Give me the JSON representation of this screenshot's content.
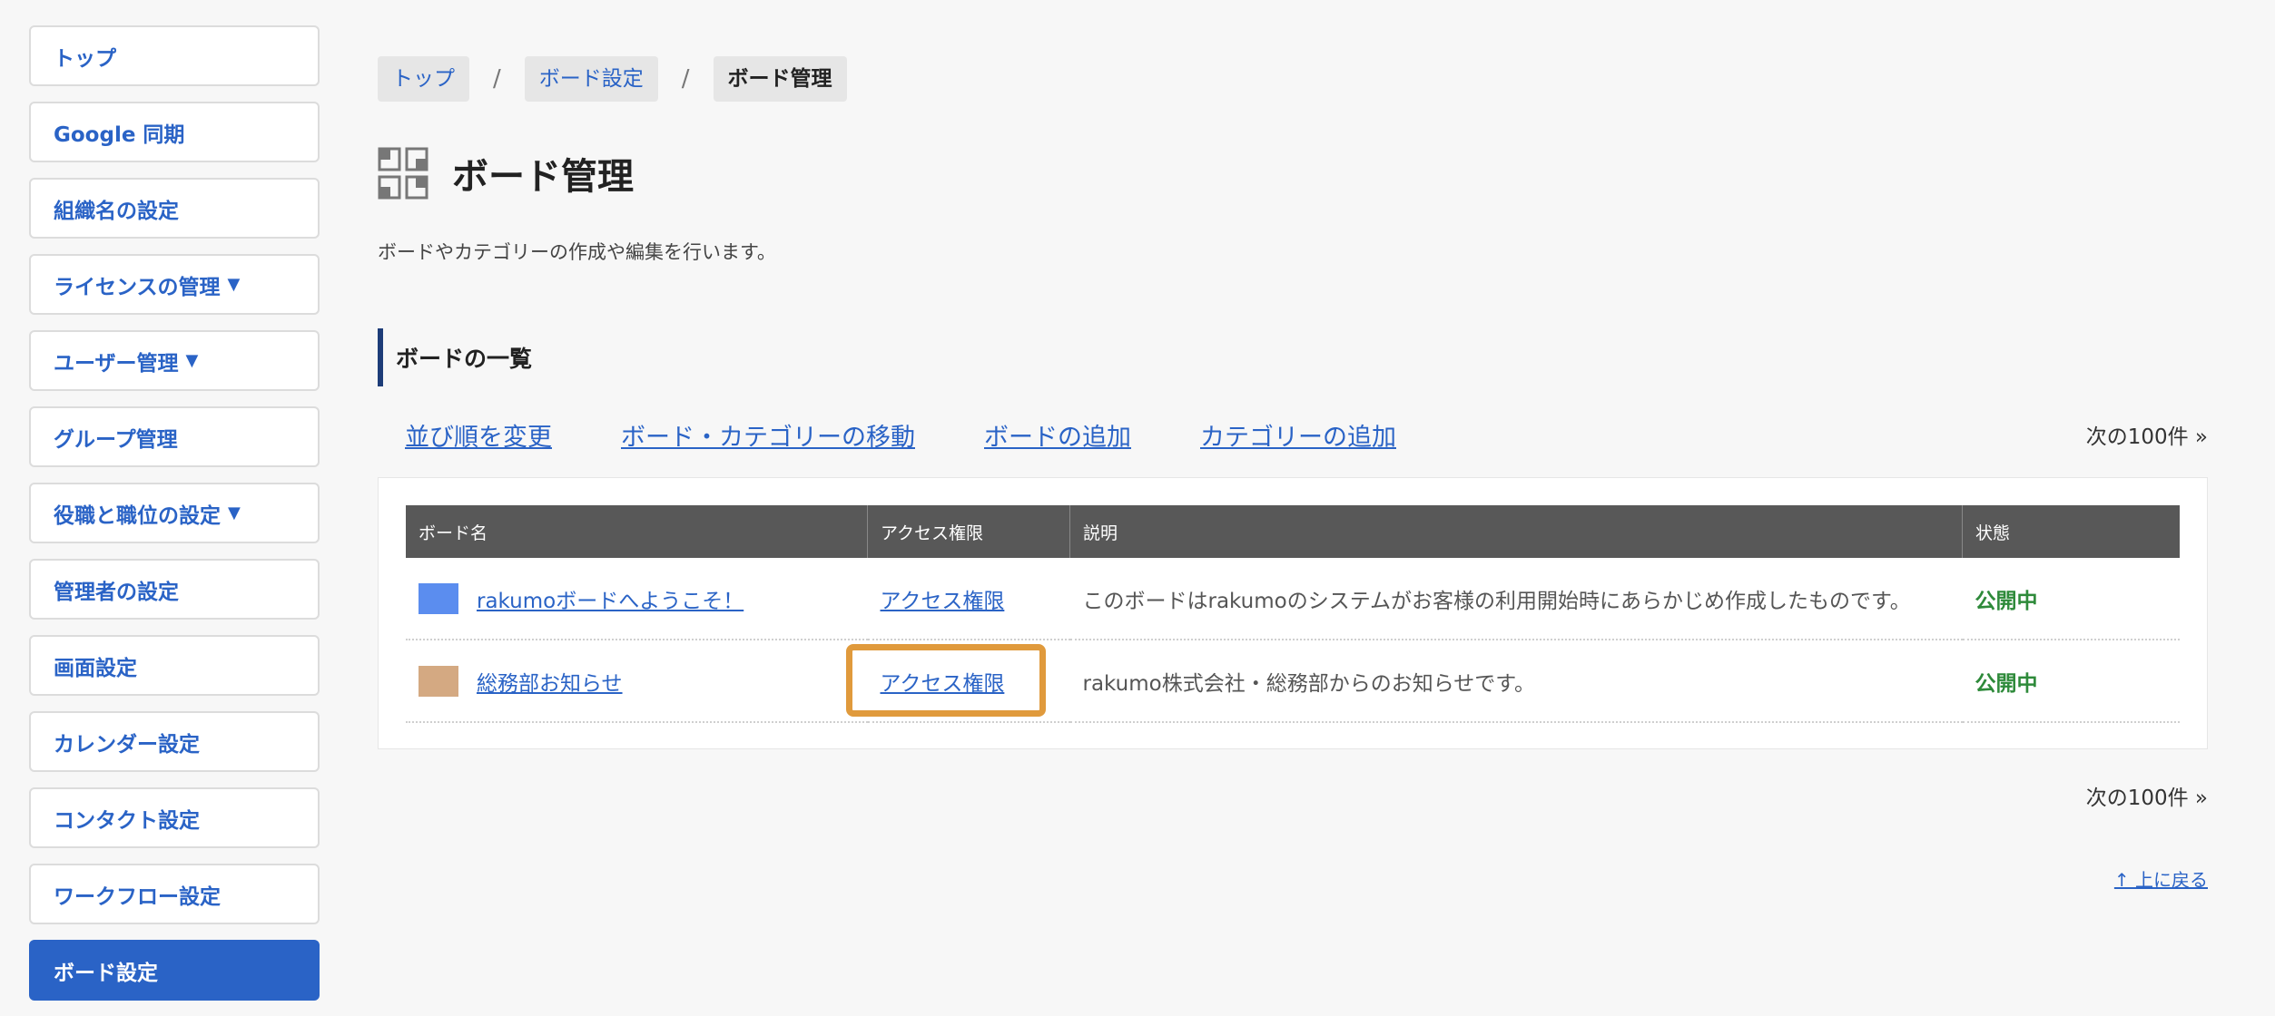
{
  "sidebar": {
    "items": [
      {
        "label": "トップ",
        "caret": "",
        "active": false
      },
      {
        "label": "Google 同期",
        "caret": "",
        "active": false
      },
      {
        "label": "組織名の設定",
        "caret": "",
        "active": false
      },
      {
        "label": "ライセンスの管理",
        "caret": "▼",
        "active": false
      },
      {
        "label": "ユーザー管理",
        "caret": "▼",
        "active": false
      },
      {
        "label": "グループ管理",
        "caret": "",
        "active": false
      },
      {
        "label": "役職と職位の設定",
        "caret": "▼",
        "active": false
      },
      {
        "label": "管理者の設定",
        "caret": "",
        "active": false
      },
      {
        "label": "画面設定",
        "caret": "",
        "active": false
      },
      {
        "label": "カレンダー設定",
        "caret": "",
        "active": false
      },
      {
        "label": "コンタクト設定",
        "caret": "",
        "active": false
      },
      {
        "label": "ワークフロー設定",
        "caret": "",
        "active": false
      },
      {
        "label": "ボード設定",
        "caret": "",
        "active": true
      }
    ]
  },
  "breadcrumb": {
    "items": [
      "トップ",
      "ボード設定",
      "ボード管理"
    ],
    "separator": "/"
  },
  "header": {
    "title": "ボード管理",
    "icon": "board-grid-icon",
    "description": "ボードやカテゴリーの作成や編集を行います。"
  },
  "section": {
    "heading": "ボードの一覧"
  },
  "actions": {
    "links": [
      "並び順を変更",
      "ボード・カテゴリーの移動",
      "ボードの追加",
      "カテゴリーの追加"
    ],
    "next_label": "次の100件 »"
  },
  "table": {
    "columns": [
      "ボード名",
      "アクセス権限",
      "説明",
      "状態"
    ],
    "rows": [
      {
        "color": "#5b8def",
        "name": "rakumoボードへようこそ！",
        "access": "アクセス権限",
        "description": "このボードはrakumoのシステムがお客様の利用開始時にあらかじめ作成したものです。",
        "status": "公開中",
        "highlighted": false
      },
      {
        "color": "#d4a982",
        "name": "総務部お知らせ",
        "access": "アクセス権限",
        "description": "rakumo株式会社・総務部からのお知らせです。",
        "status": "公開中",
        "highlighted": true
      }
    ]
  },
  "footer": {
    "next_label": "次の100件 »",
    "back_to_top": "↑ 上に戻る"
  },
  "colors": {
    "accent": "#2a63c6",
    "status_public": "#2e8a3a",
    "highlight": "#e09a3c",
    "table_header": "#585858"
  }
}
